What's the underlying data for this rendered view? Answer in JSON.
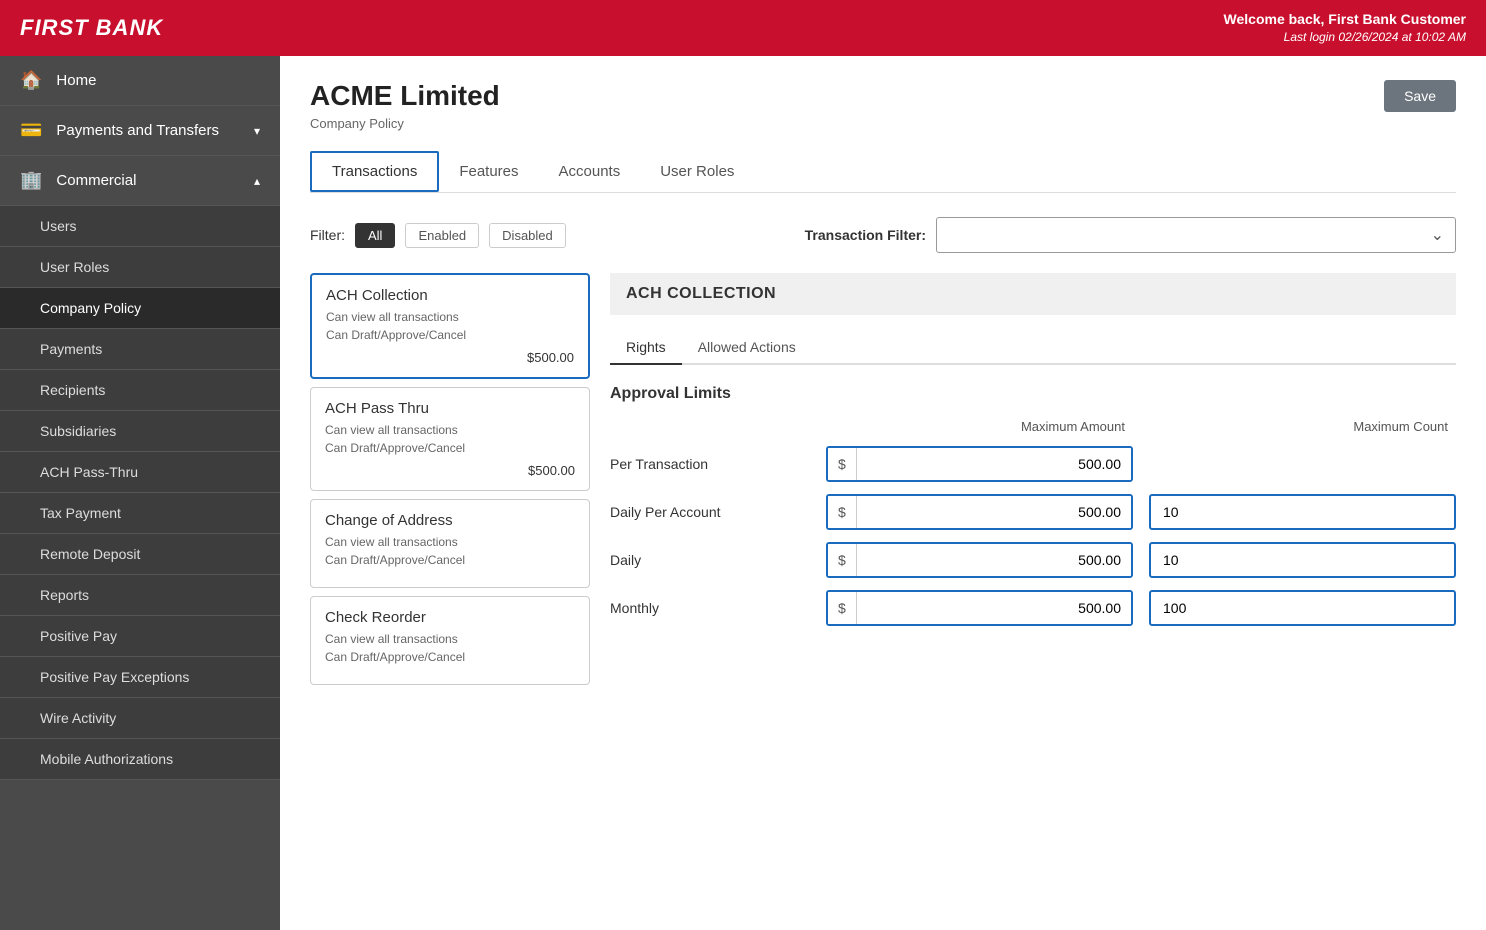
{
  "header": {
    "logo": "FIRST BANK",
    "welcome_text": "Welcome back, First Bank Customer",
    "last_login": "Last login 02/26/2024 at 10:02 AM"
  },
  "sidebar": {
    "top_items": [
      {
        "id": "home",
        "label": "Home",
        "icon": "🏠",
        "has_arrow": false
      }
    ],
    "section_items": [
      {
        "id": "payments-transfers",
        "label": "Payments and Transfers",
        "icon": "💳",
        "has_arrow": true,
        "expanded": false
      },
      {
        "id": "commercial",
        "label": "Commercial",
        "icon": "🏢",
        "has_arrow": true,
        "expanded": true
      }
    ],
    "sub_items": [
      {
        "id": "users",
        "label": "Users"
      },
      {
        "id": "user-roles",
        "label": "User Roles"
      },
      {
        "id": "company-policy",
        "label": "Company Policy",
        "active": true
      },
      {
        "id": "payments",
        "label": "Payments"
      },
      {
        "id": "recipients",
        "label": "Recipients"
      },
      {
        "id": "subsidiaries",
        "label": "Subsidiaries"
      },
      {
        "id": "ach-pass-thru",
        "label": "ACH Pass-Thru"
      },
      {
        "id": "tax-payment",
        "label": "Tax Payment"
      },
      {
        "id": "remote-deposit",
        "label": "Remote Deposit"
      },
      {
        "id": "reports",
        "label": "Reports"
      },
      {
        "id": "positive-pay",
        "label": "Positive Pay"
      },
      {
        "id": "positive-pay-exceptions",
        "label": "Positive Pay Exceptions"
      },
      {
        "id": "wire-activity",
        "label": "Wire Activity"
      },
      {
        "id": "mobile-authorizations",
        "label": "Mobile Authorizations"
      }
    ]
  },
  "content": {
    "company_name": "ACME Limited",
    "subtitle": "Company Policy",
    "save_button": "Save",
    "tabs": [
      {
        "id": "transactions",
        "label": "Transactions",
        "active": true
      },
      {
        "id": "features",
        "label": "Features",
        "active": false
      },
      {
        "id": "accounts",
        "label": "Accounts",
        "active": false
      },
      {
        "id": "user-roles",
        "label": "User Roles",
        "active": false
      }
    ],
    "filter": {
      "label": "Filter:",
      "options": [
        "All",
        "Enabled",
        "Disabled"
      ],
      "active": "All"
    },
    "transaction_filter": {
      "label": "Transaction Filter:",
      "placeholder": ""
    },
    "transactions": [
      {
        "id": "ach-collection",
        "title": "ACH Collection",
        "desc1": "Can view all transactions",
        "desc2": "Can Draft/Approve/Cancel",
        "amount": "$500.00",
        "selected": true
      },
      {
        "id": "ach-pass-thru",
        "title": "ACH Pass Thru",
        "desc1": "Can view all transactions",
        "desc2": "Can Draft/Approve/Cancel",
        "amount": "$500.00",
        "selected": false
      },
      {
        "id": "change-of-address",
        "title": "Change of Address",
        "desc1": "Can view all transactions",
        "desc2": "Can Draft/Approve/Cancel",
        "amount": "",
        "selected": false
      },
      {
        "id": "check-reorder",
        "title": "Check Reorder",
        "desc1": "Can view all transactions",
        "desc2": "Can Draft/Approve/Cancel",
        "amount": "",
        "selected": false
      }
    ],
    "detail_panel": {
      "title": "ACH COLLECTION",
      "inner_tabs": [
        {
          "id": "rights",
          "label": "Rights",
          "active": true
        },
        {
          "id": "allowed-actions",
          "label": "Allowed Actions",
          "active": false
        }
      ],
      "approval_limits": {
        "title": "Approval Limits",
        "col_headers": [
          "Maximum Amount",
          "Maximum Count"
        ],
        "rows": [
          {
            "label": "Per Transaction",
            "max_amount": "500.00",
            "max_count": "",
            "has_count": false
          },
          {
            "label": "Daily Per Account",
            "max_amount": "500.00",
            "max_count": "10",
            "has_count": true
          },
          {
            "label": "Daily",
            "max_amount": "500.00",
            "max_count": "10",
            "has_count": true
          },
          {
            "label": "Monthly",
            "max_amount": "500.00",
            "max_count": "100",
            "has_count": true
          }
        ]
      }
    }
  }
}
